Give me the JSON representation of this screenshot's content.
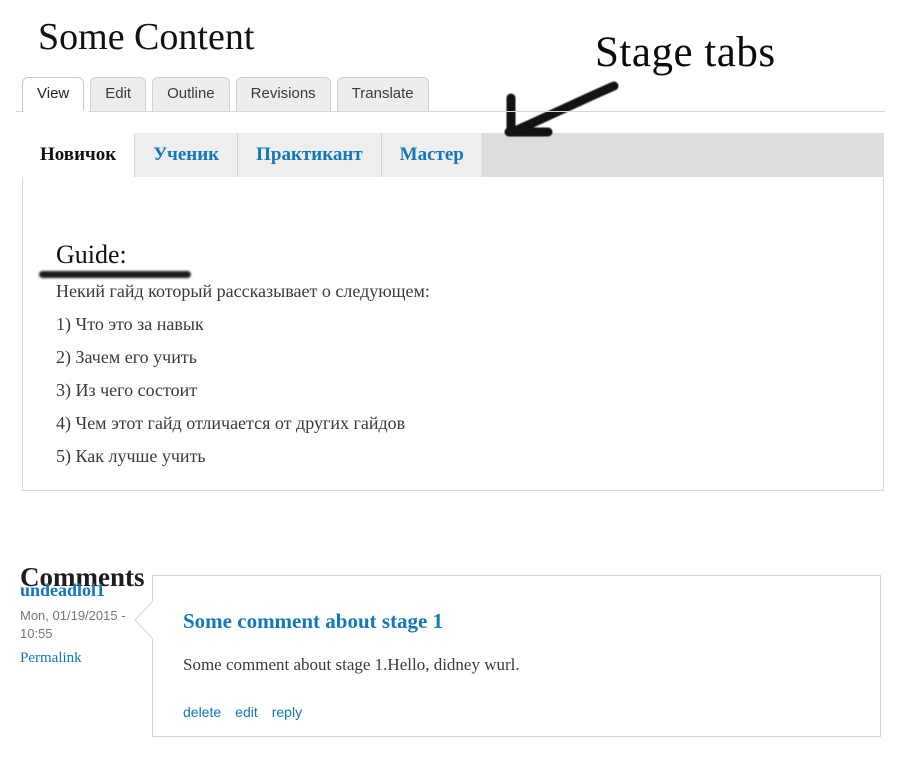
{
  "page": {
    "title": "Some Content"
  },
  "primary_tabs": [
    {
      "label": "View",
      "active": true
    },
    {
      "label": "Edit",
      "active": false
    },
    {
      "label": "Outline",
      "active": false
    },
    {
      "label": "Revisions",
      "active": false
    },
    {
      "label": "Translate",
      "active": false
    }
  ],
  "stage_tabs": [
    {
      "label": "Новичок",
      "active": true
    },
    {
      "label": "Ученик",
      "active": false
    },
    {
      "label": "Практикант",
      "active": false
    },
    {
      "label": "Мастер",
      "active": false
    }
  ],
  "guide": {
    "heading": "Guide:",
    "lines": [
      "Некий гайд который рассказывает о следующем:",
      "1) Что это за навык",
      "2) Зачем его учить",
      "3) Из чего состоит",
      "4) Чем этот гайд отличается от других гайдов",
      "5) Как лучше учить"
    ]
  },
  "comments": {
    "heading": "Comments",
    "items": [
      {
        "author": "undeadlol1",
        "date": "Mon, 01/19/2015 - 10:55",
        "permalink_label": "Permalink",
        "title": "Some comment about stage 1",
        "body": "Some comment about stage 1.Hello, didney wurl.",
        "actions": [
          {
            "label": "delete"
          },
          {
            "label": "edit"
          },
          {
            "label": "reply"
          }
        ]
      }
    ]
  },
  "annotations": {
    "stage_tabs_label": "Stage tabs",
    "arrow_name": "hand-drawn-arrow",
    "guide_underline_name": "hand-drawn-underline"
  },
  "colors": {
    "link_blue": "#1277bb",
    "tab_gray": "#ededed",
    "stage_bar_gray": "#dddddd",
    "border_gray": "#d5d5d5",
    "muted_text": "#767676",
    "annotation_black": "#0b0b0b"
  }
}
